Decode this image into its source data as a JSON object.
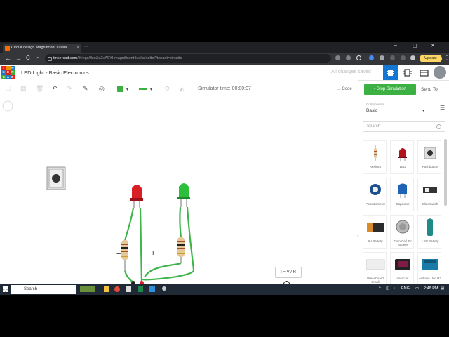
{
  "browser": {
    "tab_title": "Circuit design Magnificent Luulia",
    "tab_close": "×",
    "new_tab": "+",
    "url_host": "tinkercad.com",
    "url_path": "/things/9soZoZvA9YI-magnificent-luulia/editel?tenant=circuits",
    "update_label": "Update",
    "minimize": "–",
    "maximize": "▢",
    "close": "✕",
    "back": "←",
    "forward": "→",
    "reload": "C",
    "menu": "⋮"
  },
  "app": {
    "logo_letters": [
      "T",
      "I",
      "N",
      "K",
      "E",
      "R",
      "C",
      "A",
      "D"
    ],
    "title": "LED Light - Basic Electronics",
    "save_status": "All changes saved"
  },
  "toolbar": {
    "sim_time": "Simulator time: 00:00:07",
    "code_label": "Code",
    "stop_label": "Stop Simulation",
    "send_label": "Send To"
  },
  "canvas": {
    "formula": "I = V / R",
    "minus_sign": "−",
    "plus_sign": "+"
  },
  "sidebar": {
    "components_label": "Components",
    "selected_set": "Basic",
    "search_placeholder": "Search",
    "collapse": "❯",
    "items": [
      {
        "label": "Resistor"
      },
      {
        "label": "LED"
      },
      {
        "label": "Pushbutton"
      },
      {
        "label": "Potentiometer"
      },
      {
        "label": "Capacitor"
      },
      {
        "label": "Slideswitch"
      },
      {
        "label": "9V Battery"
      },
      {
        "label": "Coin Cell 3V Battery"
      },
      {
        "label": "1.5V Battery"
      },
      {
        "label": "Breadboard Small"
      },
      {
        "label": "micro:bit"
      },
      {
        "label": "Arduino Uno R3"
      }
    ]
  },
  "taskbar": {
    "search_label": "Search",
    "lang": "ENG",
    "time": "2:48 PM"
  },
  "colors": {
    "accent_green": "#3cb043",
    "active_view": "#1477d4",
    "wire_green": "#3fb54a",
    "led_red": "#d81f26",
    "led_green": "#2bbf3b"
  }
}
